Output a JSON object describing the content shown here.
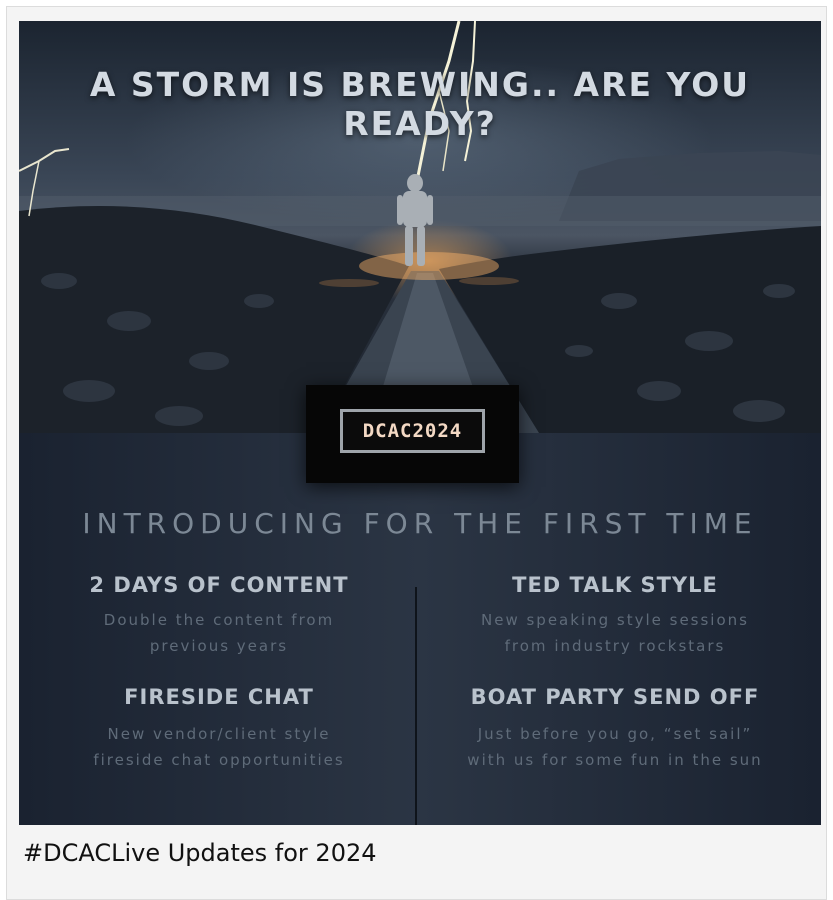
{
  "poster": {
    "headline": "A STORM IS BREWING.. ARE YOU READY?",
    "logo_text": "DCAC2024",
    "intro": "INTRODUCING FOR THE FIRST TIME",
    "features": [
      {
        "title": "2 DAYS OF CONTENT",
        "line1": "Double the content from",
        "line2": "previous years"
      },
      {
        "title": "TED TALK STYLE",
        "line1": "New speaking style sessions",
        "line2": "from industry rockstars"
      },
      {
        "title": "FIRESIDE CHAT",
        "line1": "New vendor/client style",
        "line2": "fireside chat opportunities"
      },
      {
        "title": "BOAT PARTY SEND OFF",
        "line1": "Just before you go, “set sail”",
        "line2": "with us for some fun in the sun"
      }
    ]
  },
  "caption": "#DCACLive Updates for 2024",
  "colors": {
    "poster_bg": "#1d2531",
    "headline": "#d3dae2",
    "logo_text": "#f3d9c4",
    "intro": "#7c8895",
    "feature_title": "#b9c2cc",
    "feature_desc": "#5f6b79"
  }
}
